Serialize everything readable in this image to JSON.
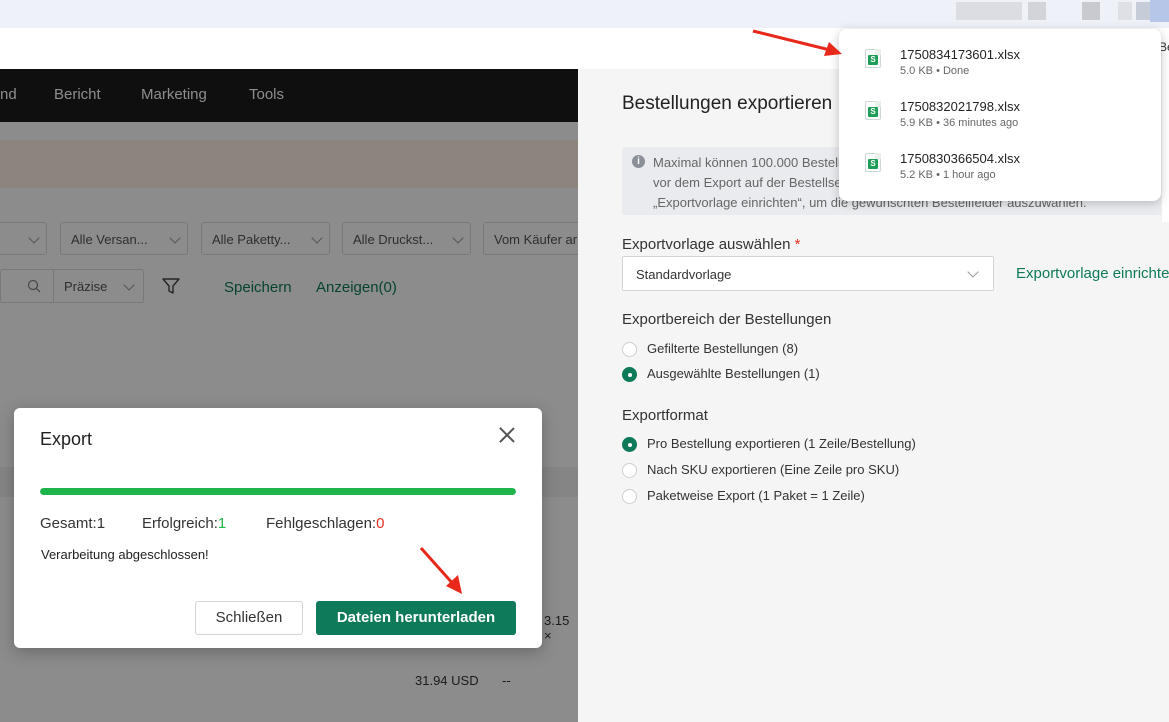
{
  "nav": {
    "items": [
      "nd",
      "Bericht",
      "Marketing",
      "Tools"
    ]
  },
  "background": {
    "filters": [
      "",
      "Alle Versan...",
      "Alle Paketty...",
      "Alle Druckst...",
      "Vom Käufer ar"
    ],
    "search_mode": "Präzise",
    "save_link": "Speichern",
    "show_link": "Anzeigen(0)",
    "amount_partial": "3.15 ×",
    "amount": "31.94 USD",
    "amount_dash": "--"
  },
  "drawer": {
    "title": "Bestellungen exportieren",
    "info_lines": [
      "Maximal können 100.000 Bestellungen auf einmal exportiert werden. Bitte",
      "vor dem Export auf der Bestellseite filtern. Klicken Sie auf",
      "„Exportvorlage einrichten“, um die gewünschten Bestellfelder auszuwählen."
    ],
    "template_label": "Exportvorlage auswählen",
    "template_required": "*",
    "template_value": "Standardvorlage",
    "template_link": "Exportvorlage einrichten",
    "range_label": "Exportbereich der Bestellungen",
    "range_options": [
      "Gefilterte Bestellungen (8)",
      "Ausgewählte Bestellungen (1)"
    ],
    "format_label": "Exportformat",
    "format_options": [
      "Pro Bestellung exportieren (1 Zeile/Bestellung)",
      "Nach SKU exportieren (Eine Zeile pro SKU)",
      "Paketweise Export (1 Paket = 1 Zeile)"
    ]
  },
  "downloads": {
    "items": [
      {
        "name": "1750834173601.xlsx",
        "meta": "5.0 KB • Done"
      },
      {
        "name": "1750832021798.xlsx",
        "meta": "5.9 KB • 36 minutes ago"
      },
      {
        "name": "1750830366504.xlsx",
        "meta": "5.2 KB • 1 hour ago"
      }
    ],
    "cut_text": "Be"
  },
  "modal": {
    "title": "Export",
    "progress_percent": 100,
    "total_label": "Gesamt:",
    "total_value": "1",
    "success_label": "Erfolgreich:",
    "success_value": "1",
    "failed_label": "Fehlgeschlagen:",
    "failed_value": "0",
    "status_text": "Verarbeitung abgeschlossen!",
    "close_button": "Schließen",
    "download_button": "Dateien herunterladen"
  },
  "colors": {
    "accent": "#0e7a5a",
    "progress": "#1db44a",
    "error": "#e0301e",
    "annotation": "#e8281b"
  }
}
